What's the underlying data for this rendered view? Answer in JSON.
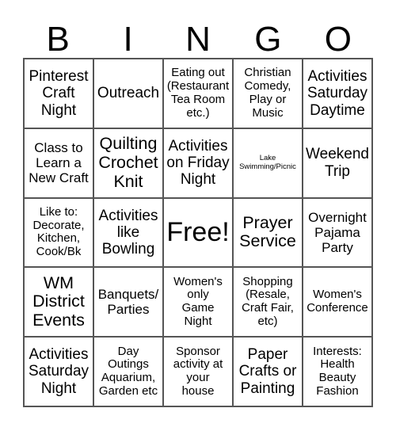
{
  "header": [
    "B",
    "I",
    "N",
    "G",
    "O"
  ],
  "cells": [
    {
      "text": "Pinterest\nCraft\nNight",
      "size": "s4"
    },
    {
      "text": "Outreach",
      "size": "s4"
    },
    {
      "text": "Eating out\n(Restaurant\nTea Room\netc.)",
      "size": "s2"
    },
    {
      "text": "Christian\nComedy,\nPlay or\nMusic",
      "size": "s2"
    },
    {
      "text": "Activities\nSaturday\nDaytime",
      "size": "s4"
    },
    {
      "text": "Class to\nLearn a\nNew Craft",
      "size": "s3"
    },
    {
      "text": "Quilting\nCrochet\nKnit",
      "size": "s5"
    },
    {
      "text": "Activities\non Friday\nNight",
      "size": "s4"
    },
    {
      "text": "Lake\nSwimming/Picnic",
      "size": "s1"
    },
    {
      "text": "Weekend\nTrip",
      "size": "s4"
    },
    {
      "text": "Like to:\nDecorate,\nKitchen,\nCook/Bk",
      "size": "s2"
    },
    {
      "text": "Activities\nlike\nBowling",
      "size": "s4"
    },
    {
      "text": "Free!",
      "size": "s6"
    },
    {
      "text": "Prayer\nService",
      "size": "s5"
    },
    {
      "text": "Overnight\nPajama\nParty",
      "size": "s3"
    },
    {
      "text": "WM\nDistrict\nEvents",
      "size": "s5"
    },
    {
      "text": "Banquets/\nParties",
      "size": "s3"
    },
    {
      "text": "Women's\nonly\nGame\nNight",
      "size": "s2"
    },
    {
      "text": "Shopping\n(Resale,\nCraft Fair,\netc)",
      "size": "s2"
    },
    {
      "text": "Women's\nConference",
      "size": "s2"
    },
    {
      "text": "Activities\nSaturday\nNight",
      "size": "s4"
    },
    {
      "text": "Day\nOutings\nAquarium,\nGarden etc",
      "size": "s2"
    },
    {
      "text": "Sponsor\nactivity at\nyour\nhouse",
      "size": "s2"
    },
    {
      "text": "Paper\nCrafts or\nPainting",
      "size": "s4"
    },
    {
      "text": "Interests:\nHealth\nBeauty\nFashion",
      "size": "s2"
    }
  ]
}
